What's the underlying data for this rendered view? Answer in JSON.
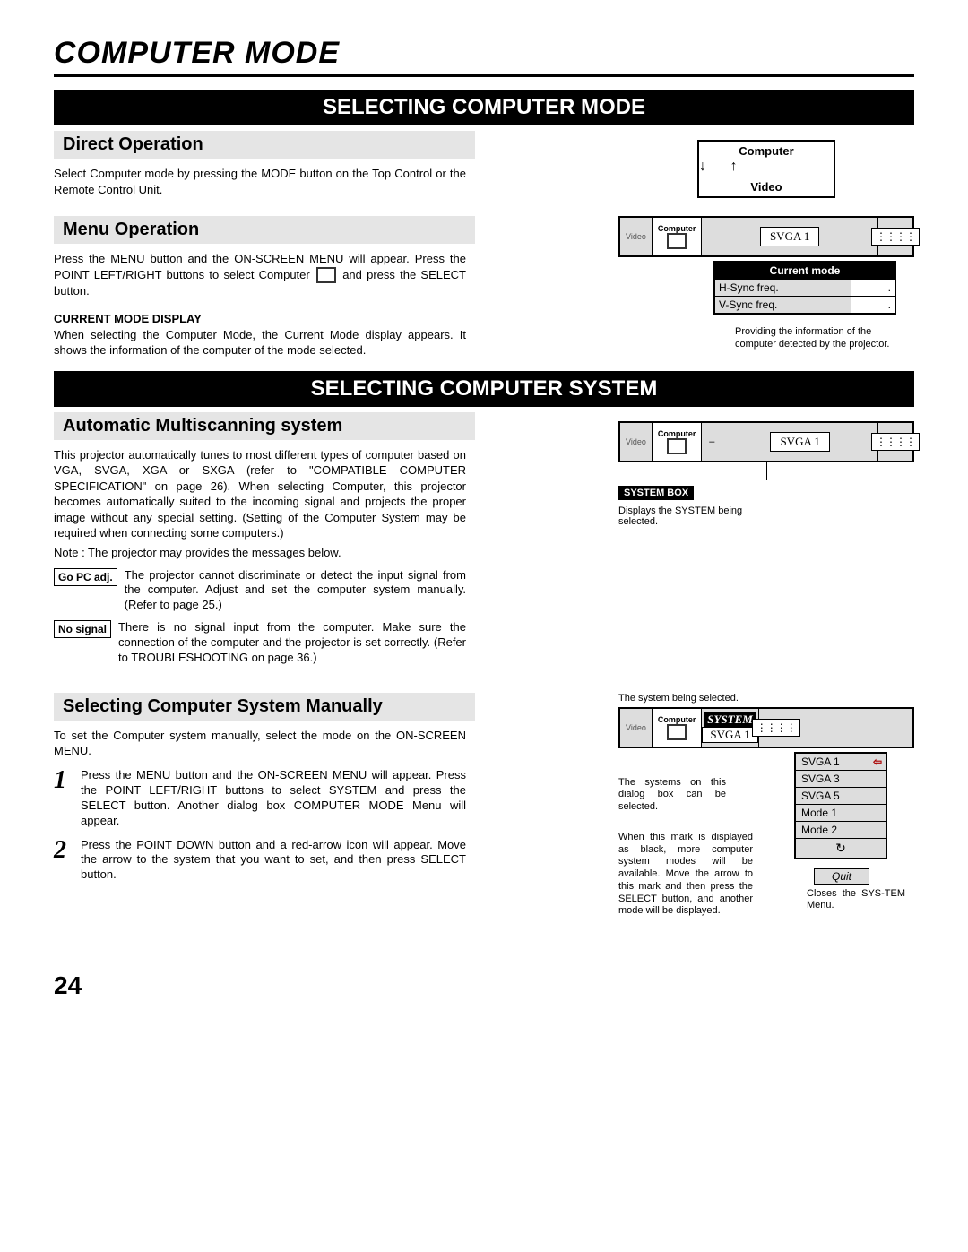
{
  "pageTitle": "COMPUTER MODE",
  "blackBar1": "SELECTING COMPUTER MODE",
  "subDirect": "Direct Operation",
  "directText": "Select Computer mode by pressing the MODE button on the Top Control or the Remote Control Unit.",
  "subMenu": "Menu Operation",
  "menuText1": "Press the MENU button and the ON-SCREEN MENU will appear. Press the POINT LEFT/RIGHT buttons to select Computer",
  "menuText2": "and press the SELECT button.",
  "cmDisplayHead": "CURRENT MODE DISPLAY",
  "cmDisplayText": "When selecting the Computer Mode, the Current Mode display appears. It shows the information of the computer of the mode selected.",
  "modeBox": {
    "computer": "Computer",
    "video": "Video"
  },
  "menuStrip": {
    "video": "Video",
    "computer": "Computer",
    "svga": "SVGA 1",
    "system": "SYSTEM"
  },
  "currentMode": {
    "title": "Current mode",
    "hsync": "H-Sync freq.",
    "vsync": "V-Sync freq.",
    "dot": "."
  },
  "cmCaption": "Providing the information of the computer detected by the projector.",
  "blackBar2": "SELECTING COMPUTER SYSTEM",
  "subAuto": "Automatic Multiscanning system",
  "autoText": "This projector automatically tunes to most different types of computer based on VGA, SVGA, XGA or SXGA (refer to \"COMPATIBLE COMPUTER SPECIFICATION\" on page 26).  When selecting Computer, this projector becomes automatically suited to the incoming signal and projects the proper image without any special setting. (Setting of the Computer System may be required when connecting some computers.)",
  "autoNote": "Note : The projector may provides the messages below.",
  "goPc": "Go PC adj.",
  "goPcText": "The projector cannot discriminate or detect the input signal from the computer.  Adjust and set the computer system manually.  (Refer to page 25.)",
  "noSignal": "No signal",
  "noSignalText": "There is no signal input from the computer.  Make sure the connection of the computer and the projector is set correctly.  (Refer to TROUBLESHOOTING on page 36.)",
  "sysBoxLabel": "SYSTEM BOX",
  "sysBoxText": "Displays the SYSTEM being selected.",
  "subManual": "Selecting Computer System Manually",
  "manualText": "To set the Computer system manually, select the mode on the ON-SCREEN MENU.",
  "step1": "Press the MENU button and the ON-SCREEN MENU will appear. Press the POINT LEFT/RIGHT buttons to select SYSTEM and press the SELECT button.  Another dialog box COMPUTER MODE Menu will appear.",
  "step2": "Press the POINT DOWN button and a red-arrow icon will appear. Move the arrow to the system that you want to set, and then press SELECT button.",
  "capTop": "The system being selected.",
  "capLeft": "The systems on this dialog box can be selected.",
  "capWhen": "When this mark is displayed as black, more computer system modes will be available.  Move the arrow to this mark and then press the SELECT button, and another mode will be displayed.",
  "capQuit": "Closes the SYS-TEM Menu.",
  "dropdown": {
    "o1": "SVGA 1",
    "o2": "SVGA 3",
    "o3": "SVGA 5",
    "o4": "Mode  1",
    "o5": "Mode  2"
  },
  "quit": "Quit",
  "pageNum": "24",
  "hash": "⋮⋮⋮⋮"
}
